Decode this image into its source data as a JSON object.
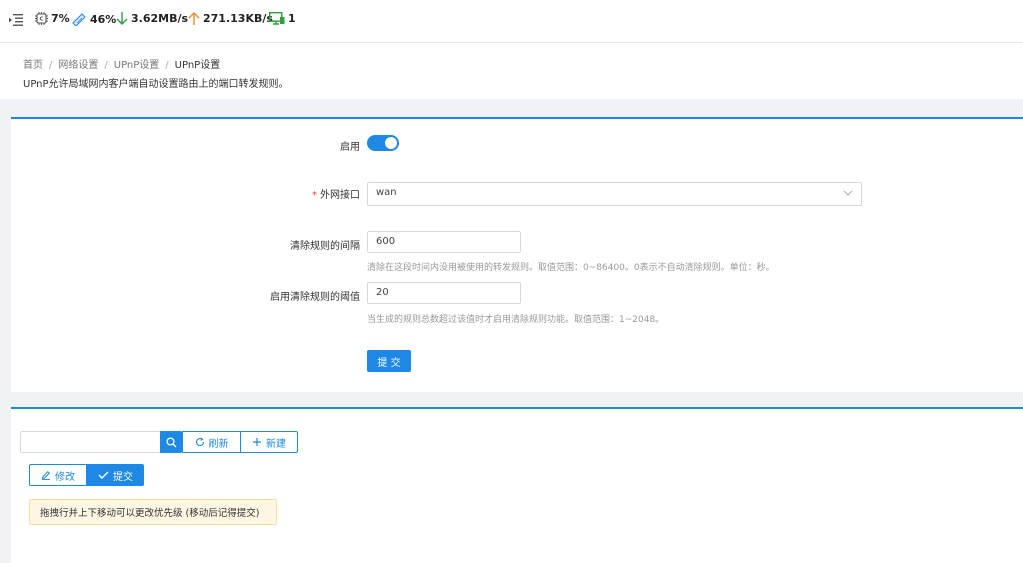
{
  "status": {
    "cpu": "7%",
    "mem": "46%",
    "down": "3.62MB/s",
    "up": "271.13KB/s",
    "clients": "1"
  },
  "breadcrumb": [
    "首页",
    "网络设置",
    "UPnP设置",
    "UPnP设置"
  ],
  "description": "UPnP允许局域网内客户端自动设置路由上的端口转发规则。",
  "form": {
    "enable_label": "启用",
    "enabled": true,
    "wan_label": "外网接口",
    "required_mark": "*",
    "wan_value": "wan",
    "interval_label": "清除规则的间隔",
    "interval_value": "600",
    "interval_hint": "清除在这段时间内没用被使用的转发规则。取值范围：0~86400。0表示不自动清除规则。单位：秒。",
    "threshold_label": "启用清除规则的阈值",
    "threshold_value": "20",
    "threshold_hint": "当生成的规则总数超过该值时才启用清除规则功能。取值范围：1~2048。",
    "submit_label": "提 交"
  },
  "toolbar": {
    "search_placeholder": "",
    "refresh_label": "刷新",
    "new_label": "新建",
    "edit_label": "修改",
    "commit_label": "提交"
  },
  "notice": "拖拽行并上下移动可以更改优先级 (移动后记得提交)",
  "colors": {
    "accent": "#1e88e5",
    "download": "#2e9e3e",
    "upload": "#f08a24",
    "required": "#e53935"
  }
}
